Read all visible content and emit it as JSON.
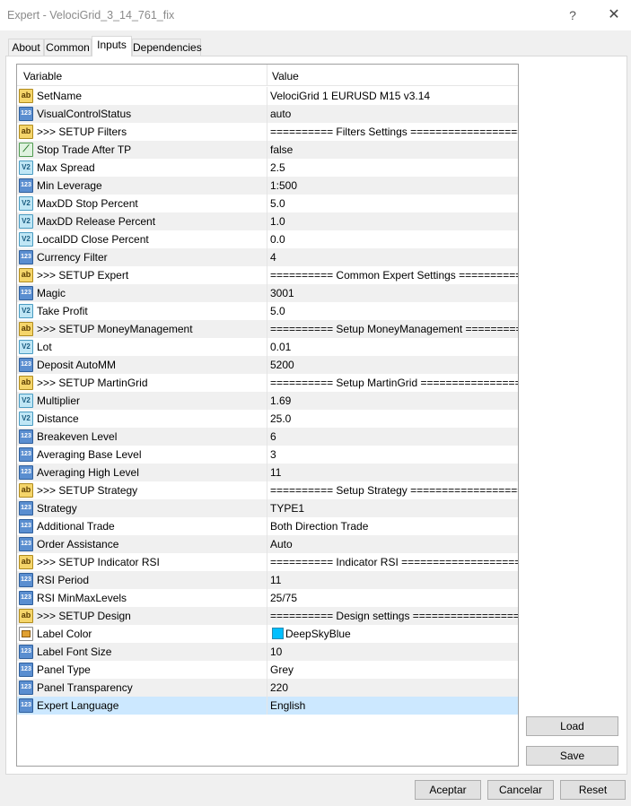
{
  "window": {
    "title": "Expert - VelociGrid_3_14_761_fix",
    "help_glyph": "?",
    "close_glyph": "✕"
  },
  "tabs": [
    {
      "label": "About"
    },
    {
      "label": "Common"
    },
    {
      "label": "Inputs"
    },
    {
      "label": "Dependencies"
    }
  ],
  "grid": {
    "col_variable": "Variable",
    "col_value": "Value",
    "rows": [
      {
        "icon": "ab",
        "variable": "SetName",
        "value": "VelociGrid 1 EURUSD M15 v3.14"
      },
      {
        "icon": "num",
        "variable": "VisualControlStatus",
        "value": "auto"
      },
      {
        "icon": "ab",
        "variable": ">>> SETUP Filters",
        "value": "========== Filters Settings =================="
      },
      {
        "icon": "chart",
        "variable": "Stop Trade After TP",
        "value": "false"
      },
      {
        "icon": "v2",
        "variable": "Max Spread",
        "value": "2.5"
      },
      {
        "icon": "num",
        "variable": "Min Leverage",
        "value": "1:500"
      },
      {
        "icon": "v2",
        "variable": "MaxDD Stop Percent",
        "value": "5.0"
      },
      {
        "icon": "v2",
        "variable": "MaxDD Release Percent",
        "value": "1.0"
      },
      {
        "icon": "v2",
        "variable": "LocalDD Close Percent",
        "value": "0.0"
      },
      {
        "icon": "num",
        "variable": "Currency Filter",
        "value": "4"
      },
      {
        "icon": "ab",
        "variable": ">>> SETUP Expert",
        "value": "========== Common Expert Settings ============"
      },
      {
        "icon": "num",
        "variable": "Magic",
        "value": "3001"
      },
      {
        "icon": "v2",
        "variable": "Take Profit",
        "value": "5.0"
      },
      {
        "icon": "ab",
        "variable": ">>> SETUP MoneyManagement",
        "value": "========== Setup MoneyManagement ============="
      },
      {
        "icon": "v2",
        "variable": "Lot",
        "value": "0.01"
      },
      {
        "icon": "num",
        "variable": "Deposit AutoMM",
        "value": "5200"
      },
      {
        "icon": "ab",
        "variable": ">>> SETUP MartinGrid",
        "value": "========== Setup MartinGrid =================="
      },
      {
        "icon": "v2",
        "variable": "Multiplier",
        "value": "1.69"
      },
      {
        "icon": "v2",
        "variable": "Distance",
        "value": "25.0"
      },
      {
        "icon": "num",
        "variable": "Breakeven Level",
        "value": "6"
      },
      {
        "icon": "num",
        "variable": "Averaging Base Level",
        "value": "3"
      },
      {
        "icon": "num",
        "variable": "Averaging High Level",
        "value": "11"
      },
      {
        "icon": "ab",
        "variable": ">>> SETUP Strategy",
        "value": "========== Setup Strategy ===================="
      },
      {
        "icon": "num",
        "variable": "Strategy",
        "value": "TYPE1"
      },
      {
        "icon": "num",
        "variable": "Additional Trade",
        "value": "Both Direction Trade"
      },
      {
        "icon": "num",
        "variable": "Order Assistance",
        "value": "Auto"
      },
      {
        "icon": "ab",
        "variable": ">>> SETUP Indicator RSI",
        "value": "========== Indicator RSI ====================="
      },
      {
        "icon": "num",
        "variable": "RSI Period",
        "value": "11"
      },
      {
        "icon": "num",
        "variable": "RSI MinMaxLevels",
        "value": "25/75"
      },
      {
        "icon": "ab",
        "variable": ">>> SETUP Design",
        "value": "========== Design settings =================="
      },
      {
        "icon": "color",
        "variable": "Label Color",
        "value": "DeepSkyBlue",
        "swatch": "#00bfff"
      },
      {
        "icon": "num",
        "variable": "Label Font Size",
        "value": "10"
      },
      {
        "icon": "num",
        "variable": "Panel Type",
        "value": "Grey"
      },
      {
        "icon": "num",
        "variable": "Panel Transparency",
        "value": "220"
      },
      {
        "icon": "num",
        "variable": "Expert Language",
        "value": "English",
        "selected": true
      }
    ]
  },
  "icon_glyphs": {
    "ab": "ab",
    "num": "123",
    "v2": "V2",
    "chart": "⟋"
  },
  "side_buttons": {
    "load": "Load",
    "save": "Save"
  },
  "footer_buttons": {
    "accept": "Aceptar",
    "cancel": "Cancelar",
    "reset": "Reset"
  }
}
